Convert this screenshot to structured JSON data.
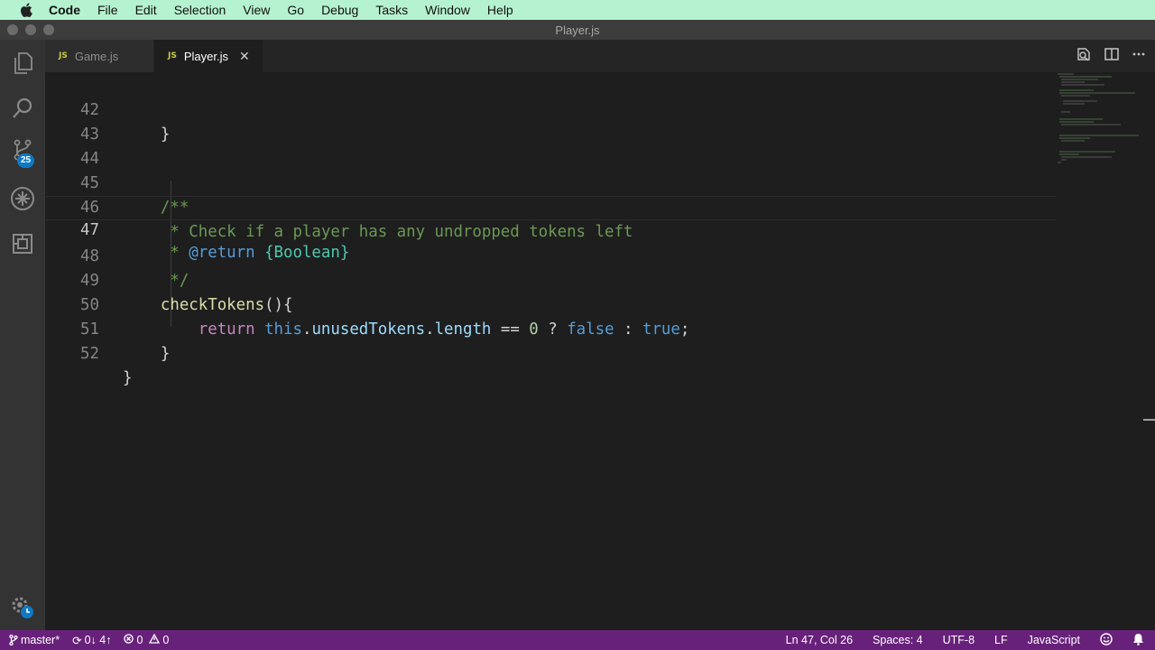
{
  "menubar": {
    "app": "Code",
    "items": [
      "File",
      "Edit",
      "Selection",
      "View",
      "Go",
      "Debug",
      "Tasks",
      "Window",
      "Help"
    ]
  },
  "window": {
    "title": "Player.js"
  },
  "activity": {
    "badge": "25"
  },
  "tabs": [
    {
      "icon": "JS",
      "label": "Game.js"
    },
    {
      "icon": "JS",
      "label": "Player.js"
    }
  ],
  "editor": {
    "lines": [
      {
        "n": "42",
        "text": "    }"
      },
      {
        "n": "43",
        "text": ""
      },
      {
        "n": "44",
        "text": ""
      },
      {
        "n": "45",
        "text": "    /**"
      },
      {
        "n": "46",
        "text": "     * Check if a player has any undropped tokens left"
      },
      {
        "n": "47",
        "text": "     * @return {Boolean}"
      },
      {
        "n": "48",
        "text": "     */"
      },
      {
        "n": "49",
        "text": "    checkTokens(){"
      },
      {
        "n": "50",
        "text": "        return this.unusedTokens.length == 0 ? false : true;"
      },
      {
        "n": "51",
        "text": "    }"
      },
      {
        "n": "52",
        "text": "}"
      }
    ],
    "current_line": "47"
  },
  "statusbar": {
    "branch": "master*",
    "sync": "0↓ 4↑",
    "errors": "0",
    "warnings": "0",
    "cursor": "Ln 47, Col 26",
    "spaces": "Spaces: 4",
    "encoding": "UTF-8",
    "eol": "LF",
    "language": "JavaScript"
  },
  "colors": {
    "menubar_bg": "#b5f2cf",
    "statusbar_bg": "#68217a",
    "editor_bg": "#1e1e1e",
    "badge_bg": "#0e7ac6"
  }
}
